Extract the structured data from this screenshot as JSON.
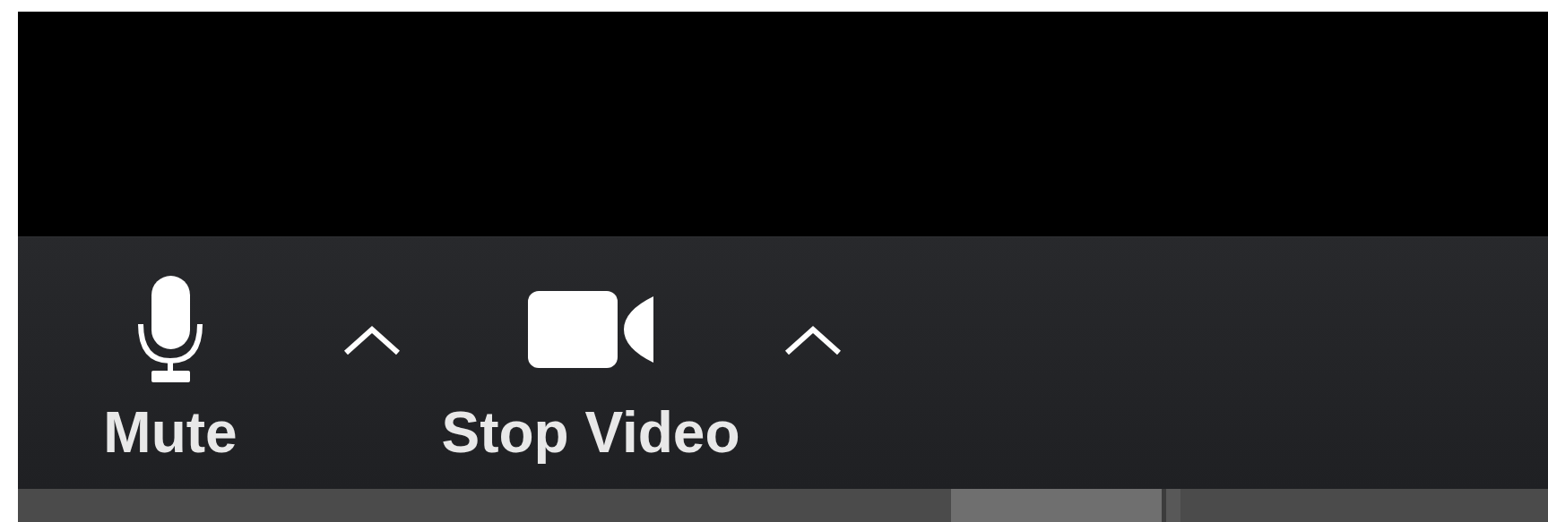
{
  "toolbar": {
    "buttons": [
      {
        "kind": "microphone",
        "label": "Mute"
      },
      {
        "kind": "camera",
        "label": "Stop Video"
      }
    ]
  }
}
